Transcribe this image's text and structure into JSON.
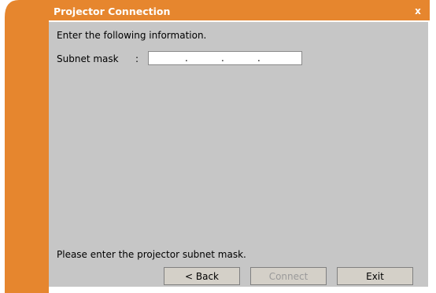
{
  "window": {
    "title": "Projector Connection",
    "close_glyph": "x"
  },
  "main": {
    "instruction": "Enter the following information.",
    "subnet_label": "Subnet mask",
    "colon": ":",
    "subnet_value": "   .   .   .   ",
    "subnet_dot": ".",
    "status": "Please enter the projector subnet mask."
  },
  "buttons": {
    "back": "< Back",
    "connect": "Connect",
    "exit": "Exit"
  },
  "colors": {
    "accent": "#e6862e",
    "panel": "#c6c6c6"
  }
}
